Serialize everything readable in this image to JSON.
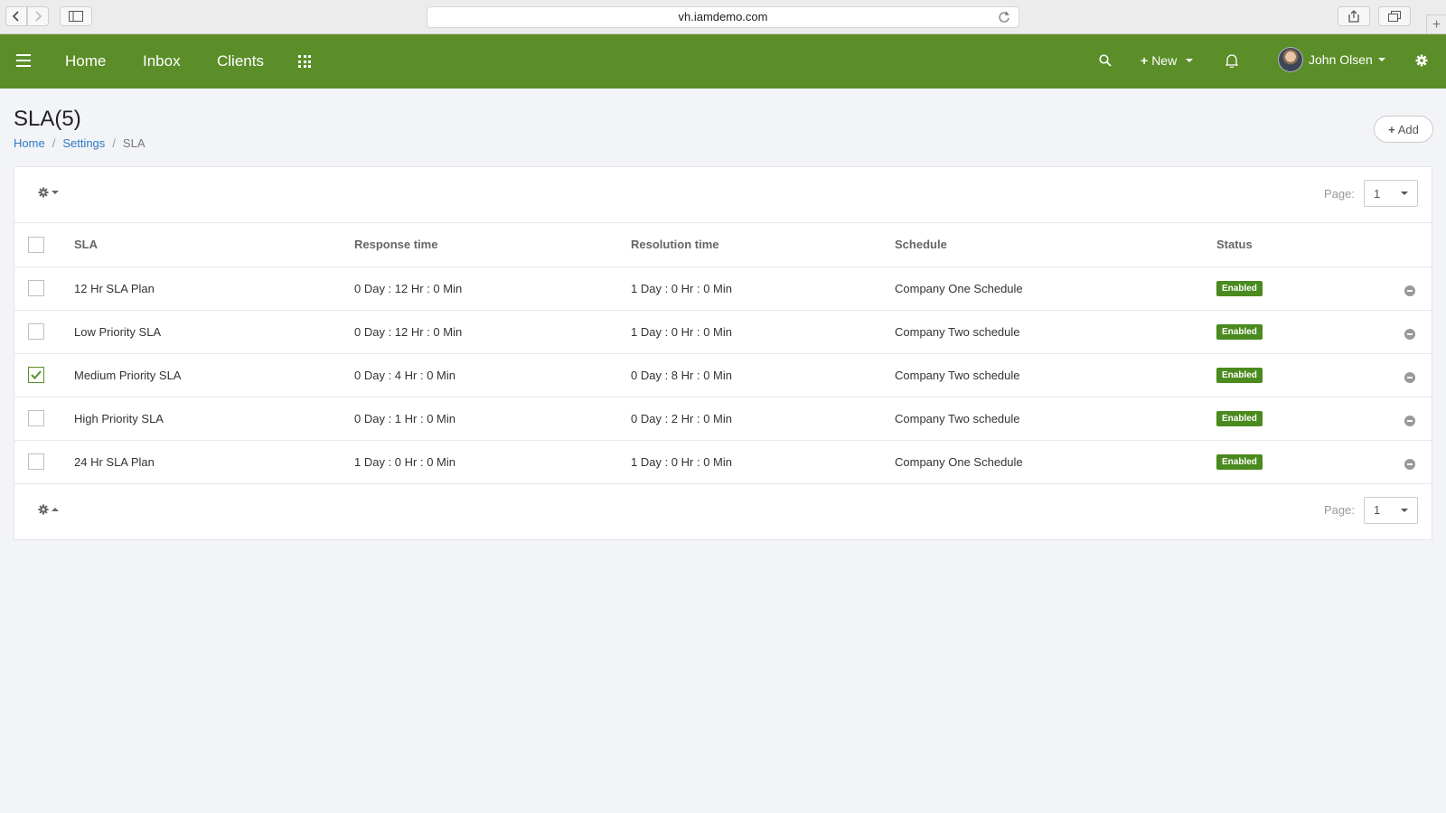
{
  "browser": {
    "url": "vh.iamdemo.com"
  },
  "nav": {
    "home": "Home",
    "inbox": "Inbox",
    "clients": "Clients",
    "new_label": "New",
    "user_name": "John Olsen"
  },
  "page": {
    "title": "SLA(5)",
    "breadcrumb": [
      "Home",
      "Settings",
      "SLA"
    ],
    "add_label": "Add"
  },
  "pager": {
    "label": "Page:",
    "value": "1"
  },
  "table": {
    "headers": [
      "SLA",
      "Response time",
      "Resolution time",
      "Schedule",
      "Status"
    ],
    "rows": [
      {
        "name": "12 Hr SLA Plan",
        "response": "0 Day : 12 Hr : 0 Min",
        "resolution": "1 Day : 0 Hr : 0 Min",
        "schedule": "Company One Schedule",
        "status": "Enabled",
        "checked": false
      },
      {
        "name": "Low Priority SLA",
        "response": "0 Day : 12 Hr : 0 Min",
        "resolution": "1 Day : 0 Hr : 0 Min",
        "schedule": "Company Two schedule",
        "status": "Enabled",
        "checked": false
      },
      {
        "name": "Medium Priority SLA",
        "response": "0 Day : 4 Hr : 0 Min",
        "resolution": "0 Day : 8 Hr : 0 Min",
        "schedule": "Company Two schedule",
        "status": "Enabled",
        "checked": true
      },
      {
        "name": "High Priority SLA",
        "response": "0 Day : 1 Hr : 0 Min",
        "resolution": "0 Day : 2 Hr : 0 Min",
        "schedule": "Company Two schedule",
        "status": "Enabled",
        "checked": false
      },
      {
        "name": "24 Hr SLA Plan",
        "response": "1 Day : 0 Hr : 0 Min",
        "resolution": "1 Day : 0 Hr : 0 Min",
        "schedule": "Company One Schedule",
        "status": "Enabled",
        "checked": false
      }
    ]
  },
  "colors": {
    "brand": "#5b8e29",
    "badge": "#4a8a1e",
    "link": "#2f78c2"
  },
  "icons": [
    "hamburger-icon",
    "apps-grid-icon",
    "search-icon",
    "plus-icon",
    "bell-icon",
    "gear-icon",
    "minus-circle-icon",
    "checkmark-icon"
  ]
}
